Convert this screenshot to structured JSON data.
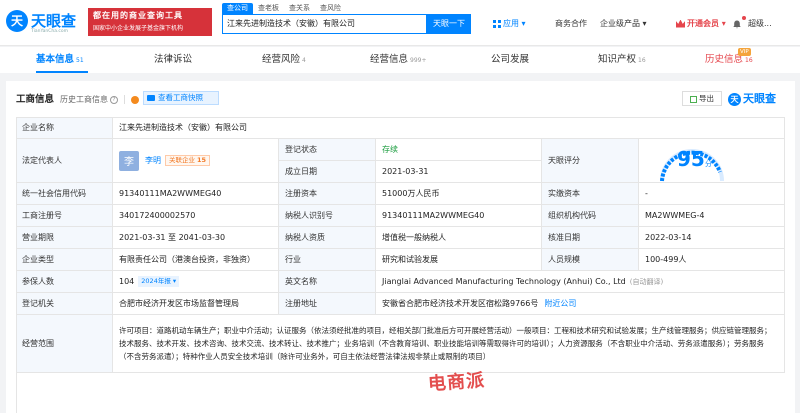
{
  "header": {
    "logo_mark": "天",
    "logo_text": "天眼查",
    "logo_sub": "TianYanCha.com",
    "slogan_line1": "都在用的商业查询工具",
    "slogan_line2": "国家中小企业发展子基金旗下机构",
    "search_tabs": [
      "查公司",
      "查老板",
      "查关系",
      "查风险"
    ],
    "search_value": "江来先进制造技术（安徽）有限公司",
    "search_button": "天眼一下",
    "app_label": "应用",
    "biz_label": "商务合作",
    "service_label": "企业级产品",
    "vip_label": "开通会员",
    "user_label": "超级..."
  },
  "tabs": [
    {
      "label": "基本信息",
      "count": "51"
    },
    {
      "label": "法律诉讼",
      "count": ""
    },
    {
      "label": "经营风险",
      "count": "4"
    },
    {
      "label": "经营信息",
      "count": "999+"
    },
    {
      "label": "公司发展",
      "count": ""
    },
    {
      "label": "知识产权",
      "count": "16"
    },
    {
      "label": "历史信息",
      "count": "16"
    }
  ],
  "vip_tag": "VIP",
  "section": {
    "title": "工商信息",
    "history_label": "历史工商信息",
    "snapshot_button": "查看工商快照",
    "export_button": "导出",
    "brand": "天眼查"
  },
  "company": {
    "name_label": "企业名称",
    "name": "江来先进制造技术（安徽）有限公司",
    "rep_label": "法定代表人",
    "rep_avatar": "李",
    "rep_name": "李明",
    "rep_badge": "关联企业",
    "rep_badge_count": "15",
    "status_label": "登记状态",
    "status": "存续",
    "founded_label": "成立日期",
    "founded": "2021-03-31",
    "score_label": "天眼评分",
    "score": "95",
    "score_unit": "分",
    "credit_label": "统一社会信用代码",
    "credit": "91340111MA2WWMEG40",
    "capital_label": "注册资本",
    "capital": "51000万人民币",
    "paid_label": "实缴资本",
    "paid": "-",
    "reg_no_label": "工商注册号",
    "reg_no": "340172400002570",
    "tax_id_label": "纳税人识别号",
    "tax_id": "91340111MA2WWMEG40",
    "org_code_label": "组织机构代码",
    "org_code": "MA2WWMEG-4",
    "term_label": "营业期限",
    "term": "2021-03-31 至 2041-03-30",
    "taxpayer_label": "纳税人资质",
    "taxpayer": "增值税一般纳税人",
    "approve_label": "核准日期",
    "approve": "2022-03-14",
    "type_label": "企业类型",
    "type": "有限责任公司（港澳台投资，非独资）",
    "industry_label": "行业",
    "industry": "研究和试验发展",
    "staff_label": "人员规模",
    "staff": "100-499人",
    "insured_label": "参保人数",
    "insured": "104",
    "insured_badge": "2024年报",
    "en_name_label": "英文名称",
    "en_name": "Jianglai Advanced Manufacturing Technology (Anhui) Co., Ltd",
    "auto_trans": "(自动翻译)",
    "authority_label": "登记机关",
    "authority": "合肥市经济开发区市场监督管理局",
    "address_label": "注册地址",
    "address": "安徽省合肥市经济技术开发区宿松路9766号",
    "nearby": "附近公司",
    "scope_label": "经营范围",
    "scope": "许可项目：道路机动车辆生产；职业中介活动；认证服务（依法须经批准的项目，经相关部门批准后方可开展经营活动）一般项目：工程和技术研究和试验发展；生产线管理服务；供应链管理服务；技术服务、技术开发、技术咨询、技术交流、技术转让、技术推广；业务培训（不含教育培训、职业技能培训等需取得许可的培训）；人力资源服务（不含职业中介活动、劳务派遣服务）；劳务服务（不含劳务派遣）；特种作业人员安全技术培训（除许可业务外，可自主依法经营法律法规非禁止或限制的项目）"
  },
  "watermark": "电商派",
  "colors": {
    "brand": "#0084ff",
    "accent_red": "#e5454c",
    "label_bg": "#f4f8fd"
  }
}
